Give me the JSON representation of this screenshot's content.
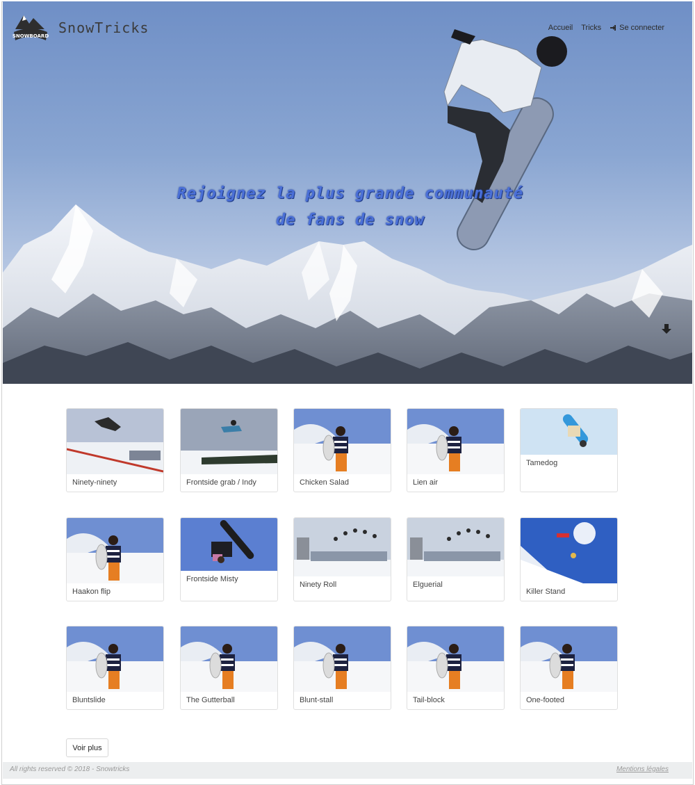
{
  "brand": {
    "logo_text": "SNOWBOARD",
    "name": "SnowTricks"
  },
  "nav": {
    "home": "Accueil",
    "tricks": "Tricks",
    "login": "Se connecter"
  },
  "hero": {
    "tagline_line1": "Rejoignez la plus grande communauté",
    "tagline_line2": "de fans de snow"
  },
  "tricks": [
    {
      "name": "Ninety-ninety",
      "image": "halfpipe"
    },
    {
      "name": "Frontside grab / Indy",
      "image": "forest-jump"
    },
    {
      "name": "Chicken Salad",
      "image": "snowboarder-woman"
    },
    {
      "name": "Lien air",
      "image": "snowboarder-woman"
    },
    {
      "name": "Tamedog",
      "image": "aerial-blue"
    },
    {
      "name": "Haakon flip",
      "image": "snowboarder-woman"
    },
    {
      "name": "Frontside Misty",
      "image": "flip-sky"
    },
    {
      "name": "Ninety Roll",
      "image": "sequence-jump"
    },
    {
      "name": "Elguerial",
      "image": "sequence-jump"
    },
    {
      "name": "Killer Stand",
      "image": "sun-jump"
    },
    {
      "name": "Bluntslide",
      "image": "snowboarder-woman"
    },
    {
      "name": "The Gutterball",
      "image": "snowboarder-woman"
    },
    {
      "name": "Blunt-stall",
      "image": "snowboarder-woman"
    },
    {
      "name": "Tail-block",
      "image": "snowboarder-woman"
    },
    {
      "name": "One-footed",
      "image": "snowboarder-woman"
    }
  ],
  "more_button": "Voir plus",
  "footer": {
    "copyright": "All rights reserved © 2018 - Snowtricks",
    "legal": "Mentions légales"
  },
  "colors": {
    "tagline": "#4b70d8",
    "sky": "#7f9ccd",
    "footer_bg": "#eceeef"
  }
}
